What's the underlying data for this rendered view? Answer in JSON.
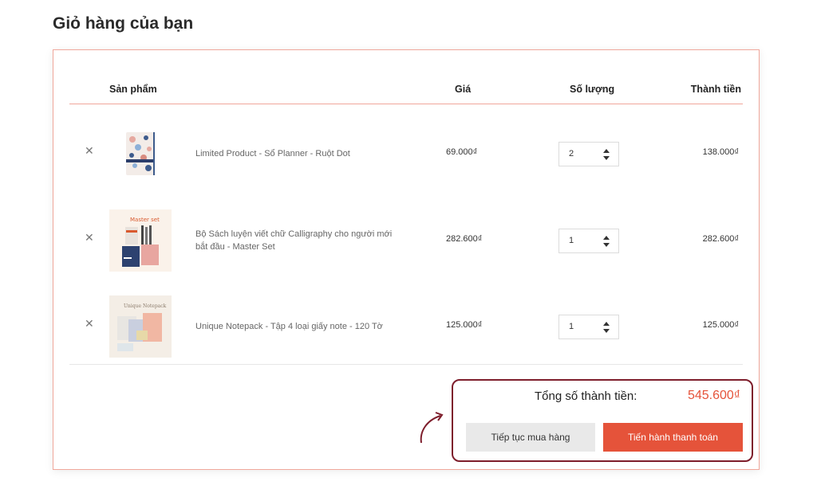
{
  "page": {
    "title": "Giỏ hàng của bạn"
  },
  "table": {
    "headers": {
      "product": "Sản phẩm",
      "price": "Giá",
      "quantity": "Số lượng",
      "total": "Thành tiền"
    },
    "rows": [
      {
        "name": "Limited Product - Sổ Planner - Ruột Dot",
        "price": "69.000₫",
        "quantity": "2",
        "total": "138.000₫",
        "image": "floral-planner-notebook"
      },
      {
        "name": "Bộ Sách luyện viết chữ Calligraphy cho người mới bắt đầu - Master Set",
        "price": "282.600₫",
        "quantity": "1",
        "total": "282.600₫",
        "image": "master-set-calligraphy"
      },
      {
        "name": "Unique Notepack - Tập 4 loại giấy note - 120 Tờ",
        "price": "125.000₫",
        "quantity": "1",
        "total": "125.000₫",
        "image": "unique-notepack"
      }
    ]
  },
  "summary": {
    "label": "Tổng số thành tiền:",
    "amount": "545.600₫",
    "continue_label": "Tiếp tục mua hàng",
    "checkout_label": "Tiến hành thanh toán"
  },
  "colors": {
    "accent": "#e5533a",
    "border": "#f0a79b",
    "highlight": "#7e1e2c"
  },
  "icons": {
    "remove": "close-icon",
    "qty_spinner": "spinner-icon",
    "annotation": "curved-arrow-icon"
  }
}
